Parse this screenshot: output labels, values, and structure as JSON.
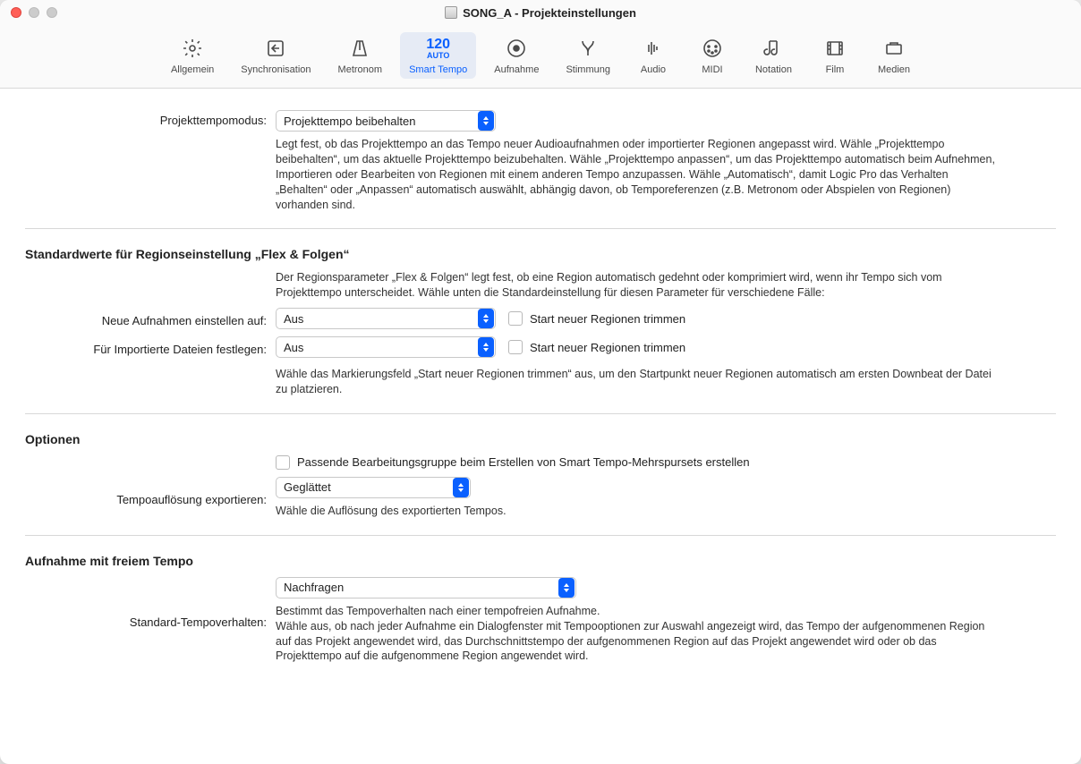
{
  "window_title": "SONG_A - Projekteinstellungen",
  "toolbar": {
    "items": [
      {
        "id": "allgemein",
        "label": "Allgemein"
      },
      {
        "id": "sync",
        "label": "Synchronisation"
      },
      {
        "id": "metronom",
        "label": "Metronom"
      },
      {
        "id": "smarttempo",
        "label": "Smart Tempo",
        "tempo_main": "120",
        "tempo_sub": "AUTO",
        "active": true
      },
      {
        "id": "aufnahme",
        "label": "Aufnahme"
      },
      {
        "id": "stimmung",
        "label": "Stimmung"
      },
      {
        "id": "audio",
        "label": "Audio"
      },
      {
        "id": "midi",
        "label": "MIDI"
      },
      {
        "id": "notation",
        "label": "Notation"
      },
      {
        "id": "film",
        "label": "Film"
      },
      {
        "id": "medien",
        "label": "Medien"
      }
    ]
  },
  "project_tempo_mode": {
    "label": "Projekttempomodus:",
    "value": "Projekttempo beibehalten",
    "desc": "Legt fest, ob das Projekttempo an das Tempo neuer Audioaufnahmen oder importierter Regionen angepasst wird. Wähle „Projekttempo beibehalten“, um das aktuelle Projekttempo beizubehalten. Wähle „Projekttempo anpassen“, um das Projekttempo automatisch beim Aufnehmen, Importieren oder Bearbeiten von Regionen mit einem anderen Tempo anzupassen. Wähle „Automatisch“, damit Logic Pro das Verhalten „Behalten“ oder „Anpassen“ automatisch auswählt, abhängig davon, ob Temporeferenzen (z.B. Metronom oder Abspielen von Regionen) vorhanden sind."
  },
  "flex_follow": {
    "title": "Standardwerte für Regionseinstellung „Flex & Folgen“",
    "desc_top": "Der Regionsparameter „Flex & Folgen“ legt fest, ob eine Region automatisch gedehnt oder komprimiert wird, wenn ihr Tempo sich vom Projekttempo unterscheidet. Wähle unten die Standardeinstellung für diesen Parameter für verschiedene Fälle:",
    "new_recordings": {
      "label": "Neue Aufnahmen einstellen auf:",
      "value": "Aus",
      "trim_label": "Start neuer Regionen trimmen"
    },
    "imported_files": {
      "label": "Für Importierte Dateien festlegen:",
      "value": "Aus",
      "trim_label": "Start neuer Regionen trimmen"
    },
    "desc_bottom": "Wähle das Markierungsfeld „Start neuer Regionen trimmen“ aus, um den Startpunkt neuer Regionen automatisch am ersten Downbeat der Datei zu platzieren."
  },
  "options": {
    "title": "Optionen",
    "edit_group_checkbox_label": "Passende Bearbeitungsgruppe beim Erstellen von Smart Tempo-Mehrspursets erstellen",
    "export_resolution": {
      "label": "Tempoauflösung exportieren:",
      "value": "Geglättet",
      "desc": "Wähle die Auflösung des exportierten Tempos."
    }
  },
  "free_tempo": {
    "title": "Aufnahme mit freiem Tempo",
    "default_behavior": {
      "label": "Standard-Tempoverhalten:",
      "value": "Nachfragen",
      "desc": "Bestimmt das Tempoverhalten nach einer tempofreien Aufnahme.\nWähle aus, ob nach jeder Aufnahme ein Dialogfenster mit Tempooptionen zur Auswahl angezeigt wird, das Tempo der aufgenommenen Region auf das Projekt angewendet wird, das Durchschnittstempo der aufgenommenen Region auf das Projekt angewendet wird oder ob das Projekttempo auf die aufgenommene Region angewendet wird."
    }
  }
}
